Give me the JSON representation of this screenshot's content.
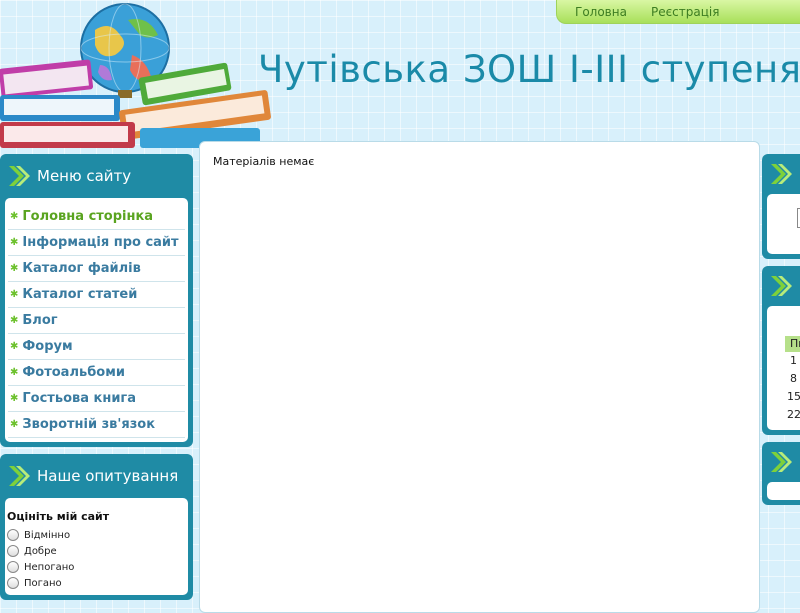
{
  "header": {
    "site_title": "Чутівська ЗОШ I-III ступеня",
    "nav": [
      "Головна",
      "Реєстрація"
    ]
  },
  "left": {
    "menu_block": {
      "title": "Меню сайту",
      "items": [
        "Головна сторінка",
        "Інформація про сайт",
        "Каталог файлів",
        "Каталог статей",
        "Блог",
        "Форум",
        "Фотоальбоми",
        "Гостьова книга",
        "Зворотній зв'язок"
      ]
    },
    "poll_block": {
      "title": "Наше опитування",
      "question": "Оцініть мій сайт",
      "options": [
        "Відмінно",
        "Добре",
        "Непогано",
        "Погано"
      ]
    }
  },
  "main": {
    "empty_text": "Матеріалів немає"
  },
  "right": {
    "calendar": {
      "day_header": "Пн",
      "mondays": [
        "1",
        "8",
        "15",
        "22"
      ]
    }
  },
  "colors": {
    "block_bg": "#1f8ba5",
    "active_link": "#5aa420",
    "link": "#3a7ba0",
    "title": "#1a8aa8",
    "nav_bg": "#b6e67a"
  }
}
